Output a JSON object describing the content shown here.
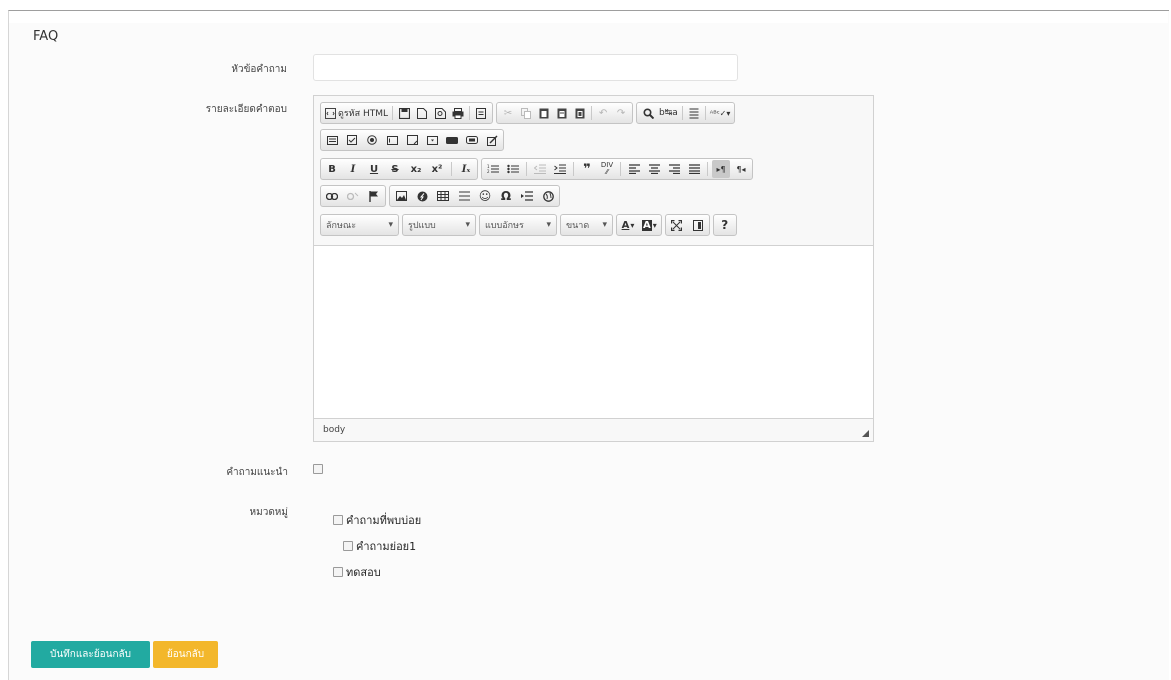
{
  "page": {
    "title": "FAQ"
  },
  "form": {
    "question_label": "หัวข้อคำถาม",
    "question_value": "",
    "answer_label": "รายละเอียดคำตอบ",
    "recommended_label": "คำถามแนะนำ",
    "category_label": "หมวดหมู่"
  },
  "editor": {
    "source_label": "ดูรหัส HTML",
    "styles_label": "ลักษณะ",
    "format_label": "รูปแบบ",
    "font_label": "แบบอักษร",
    "size_label": "ขนาด",
    "path_label": "body",
    "bold": "B",
    "italic": "I",
    "underline": "U",
    "strike": "S",
    "subscript": "x₂",
    "superscript": "x²",
    "remove_format": "Iₓ",
    "blockquote": "❞",
    "special_char": "Ω",
    "about": "?",
    "text_color": "A",
    "bg_color": "A"
  },
  "categories": [
    {
      "label": "คำถามที่พบบ่อย",
      "level": 0
    },
    {
      "label": "คำถามย่อย1",
      "level": 1
    },
    {
      "label": "ทดสอบ",
      "level": 0
    }
  ],
  "buttons": {
    "save_back": "บันทึกและย้อนกลับ",
    "back": "ย้อนกลับ"
  },
  "colors": {
    "save": "#22aaa1",
    "back": "#f3b72b"
  }
}
